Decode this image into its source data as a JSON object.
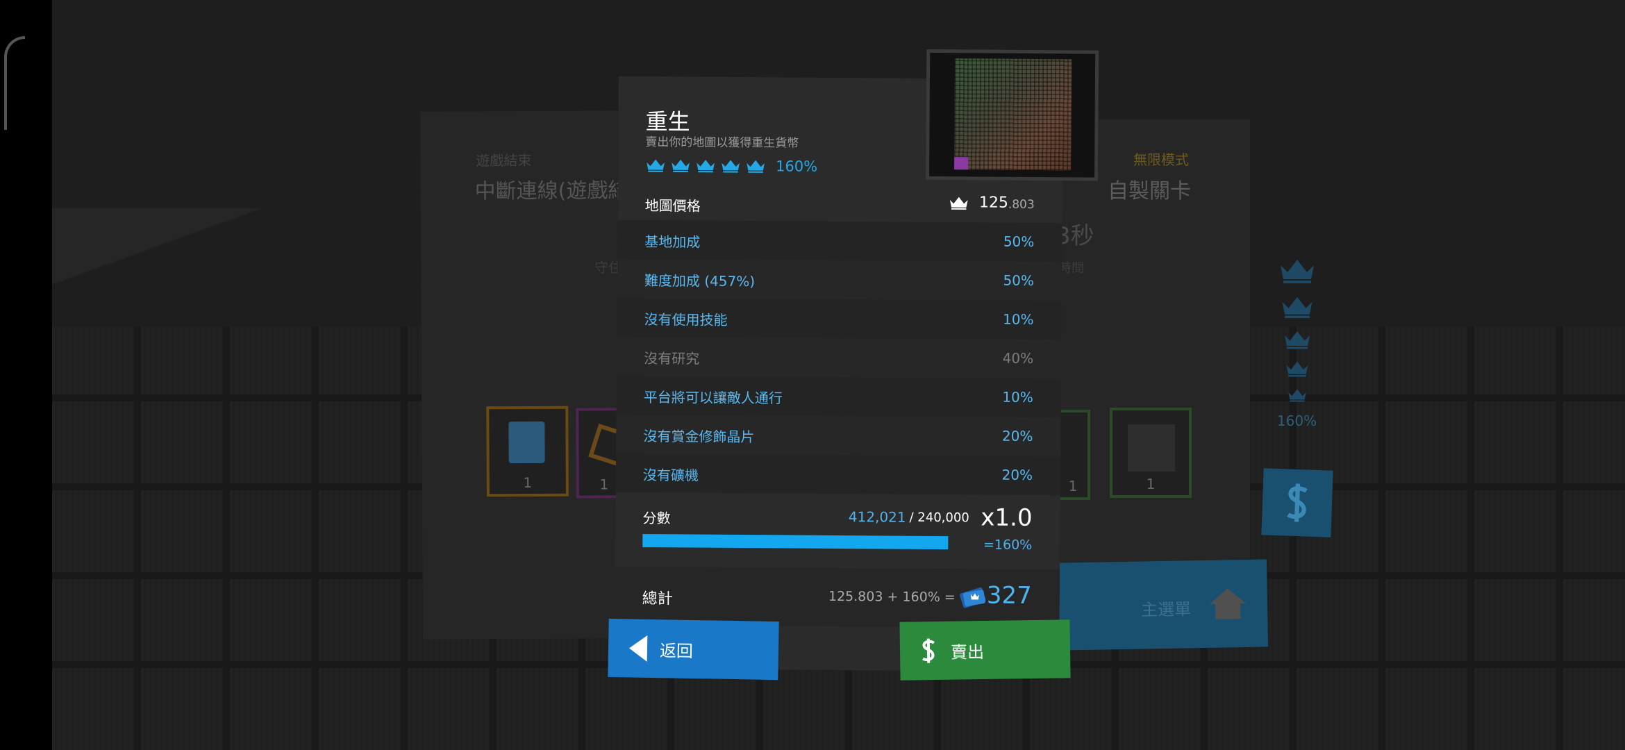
{
  "background": {
    "left_card": {
      "small_label": "遊戲結束",
      "title": "中斷連線(遊戲結",
      "sub": "守住"
    },
    "right_card": {
      "mode_label": "無限模式",
      "title": "自製關卡",
      "time": "3秒",
      "sub": "時間"
    },
    "left_items": [
      {
        "count": "1"
      },
      {
        "count": "1"
      }
    ],
    "right_items": [
      {
        "count": "1"
      },
      {
        "count": "1"
      }
    ],
    "crown_percent": "160%",
    "main_menu_label": "主選單"
  },
  "panel": {
    "title": "重生",
    "subtitle": "賣出你的地圖以獲得重生貨幣",
    "difficulty_crowns": 5,
    "difficulty_percent": "160%",
    "map_price": {
      "label": "地圖價格",
      "value_int": "125",
      "value_dec": ".803"
    },
    "bonuses": [
      {
        "label": "基地加成",
        "value": "50%",
        "active": true
      },
      {
        "label": "難度加成 (457%)",
        "value": "50%",
        "active": true
      },
      {
        "label": "沒有使用技能",
        "value": "10%",
        "active": true
      },
      {
        "label": "沒有研究",
        "value": "40%",
        "active": false
      },
      {
        "label": "平台將可以讓敵人通行",
        "value": "10%",
        "active": true
      },
      {
        "label": "沒有賞金修飾晶片",
        "value": "20%",
        "active": true
      },
      {
        "label": "沒有礦機",
        "value": "20%",
        "active": true
      }
    ],
    "score": {
      "label": "分數",
      "current": "412,021",
      "max": "/ 240,000",
      "progress": 1.0,
      "multiplier": "x1.0",
      "multiplier_percent": "=160%"
    },
    "total": {
      "label": "總計",
      "formula": "125.803 + 160% =",
      "value": "327"
    }
  },
  "buttons": {
    "back": "返回",
    "sell": "賣出"
  },
  "colors": {
    "accent_blue": "#25a9e6",
    "progress_blue": "#13a7ef",
    "back_button": "#1a78c8",
    "sell_button": "#2b8a3c"
  }
}
